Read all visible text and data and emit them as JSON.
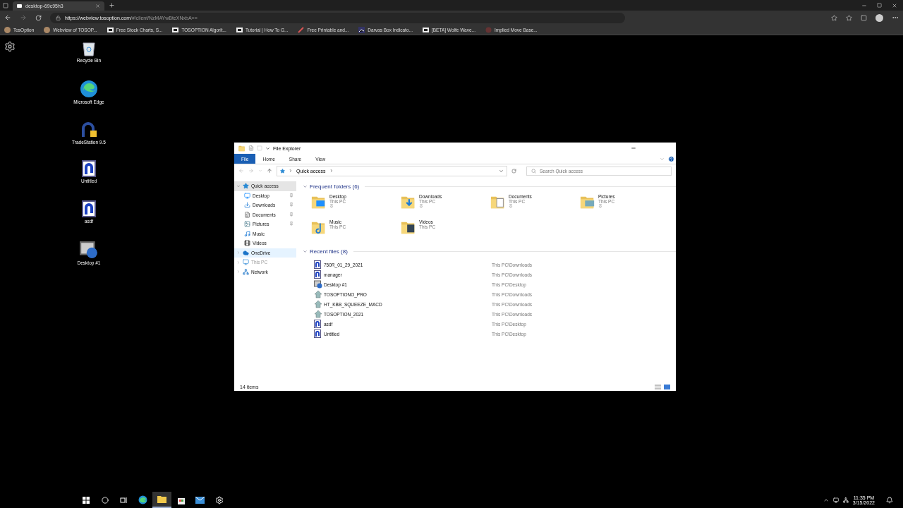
{
  "browser": {
    "tab_title": "desktop-69c95h3",
    "url_host": "https://webview.tosoption.com",
    "url_path": "/#/client/NzMAYwBteXNxbA==",
    "bookmarks": [
      {
        "label": "TosOption",
        "kind": "avatar"
      },
      {
        "label": "Webview of TOSOP...",
        "kind": "avatar"
      },
      {
        "label": "Free Stock Charts, S...",
        "kind": "tv"
      },
      {
        "label": "TOSOPTION Algorit...",
        "kind": "tv"
      },
      {
        "label": "Tutorial | How To G...",
        "kind": "tv"
      },
      {
        "label": "Free Printable and...",
        "kind": "pen"
      },
      {
        "label": "Darvas Box Indicato...",
        "kind": "chart"
      },
      {
        "label": "[BETA] Wolfe Wave...",
        "kind": "tv"
      },
      {
        "label": "Implied Move Base...",
        "kind": "dot"
      }
    ]
  },
  "desktop_icons": [
    {
      "label": "Recycle Bin",
      "kind": "recycle"
    },
    {
      "label": "Microsoft Edge",
      "kind": "edge"
    },
    {
      "label": "TradeStation 9.5",
      "kind": "trade"
    },
    {
      "label": "Untitled",
      "kind": "doc"
    },
    {
      "label": "asdf",
      "kind": "doc"
    },
    {
      "label": "Desktop #1",
      "kind": "desktop"
    }
  ],
  "explorer": {
    "title": "File Explorer",
    "ribbon_tabs": [
      {
        "label": "File",
        "selected": true
      },
      {
        "label": "Home",
        "selected": false
      },
      {
        "label": "Share",
        "selected": false
      },
      {
        "label": "View",
        "selected": false
      }
    ],
    "breadcrumb": "Quick access",
    "search": {
      "placeholder": "Search Quick access"
    },
    "nav": [
      {
        "label": "Quick access",
        "kind": "star",
        "expanded": true,
        "selected": true,
        "hovered": false,
        "children": [
          {
            "label": "Desktop",
            "kind": "desktop",
            "pinned": true
          },
          {
            "label": "Downloads",
            "kind": "downloads",
            "pinned": true
          },
          {
            "label": "Documents",
            "kind": "documents",
            "pinned": true
          },
          {
            "label": "Pictures",
            "kind": "pictures",
            "pinned": true
          },
          {
            "label": "Music",
            "kind": "music",
            "pinned": false
          },
          {
            "label": "Videos",
            "kind": "videos",
            "pinned": false
          }
        ]
      },
      {
        "label": "OneDrive",
        "kind": "cloud",
        "expanded": false,
        "selected": false,
        "hovered": true
      },
      {
        "label": "This PC",
        "kind": "pc",
        "expanded": false,
        "selected": false,
        "hovered": false
      },
      {
        "label": "Network",
        "kind": "network",
        "expanded": false,
        "selected": false,
        "hovered": false
      }
    ],
    "frequent": {
      "heading": "Frequent folders (6)",
      "expanded": true,
      "folders": [
        {
          "name": "Desktop",
          "location": "This PC",
          "pinned": true,
          "kind": "desktop"
        },
        {
          "name": "Downloads",
          "location": "This PC",
          "pinned": true,
          "kind": "downloads"
        },
        {
          "name": "Documents",
          "location": "This PC",
          "pinned": true,
          "kind": "documents"
        },
        {
          "name": "Pictures",
          "location": "This PC",
          "pinned": true,
          "kind": "pictures"
        },
        {
          "name": "Music",
          "location": "This PC",
          "pinned": false,
          "kind": "music"
        },
        {
          "name": "Videos",
          "location": "This PC",
          "pinned": false,
          "kind": "videos"
        }
      ]
    },
    "recent": {
      "heading": "Recent files (8)",
      "expanded": true,
      "files": [
        {
          "name": "750R_01_29_2021",
          "path": "This PC\\Downloads",
          "kind": "ts"
        },
        {
          "name": "manager",
          "path": "This PC\\Downloads",
          "kind": "ts"
        },
        {
          "name": "Desktop #1",
          "path": "This PC\\Desktop",
          "kind": "desktop"
        },
        {
          "name": "TOSOPTIONO_PRO",
          "path": "This PC\\Downloads",
          "kind": "els"
        },
        {
          "name": "HT_KBB_SQUEEZE_MACD",
          "path": "This PC\\Downloads",
          "kind": "els"
        },
        {
          "name": "TOSOPTION_2021",
          "path": "This PC\\Downloads",
          "kind": "els"
        },
        {
          "name": "asdf",
          "path": "This PC\\Desktop",
          "kind": "ts"
        },
        {
          "name": "Untitled",
          "path": "This PC\\Desktop",
          "kind": "ts"
        }
      ]
    },
    "status": "14 items"
  },
  "taskbar": {
    "apps": [
      {
        "kind": "start",
        "active": false
      },
      {
        "kind": "search",
        "active": false
      },
      {
        "kind": "taskview",
        "active": false
      },
      {
        "kind": "edge",
        "active": false
      },
      {
        "kind": "folder",
        "active": true
      },
      {
        "kind": "store",
        "active": false
      },
      {
        "kind": "mail",
        "active": false
      },
      {
        "kind": "gear",
        "active": false
      }
    ],
    "time": "11:35 PM",
    "date": "3/15/2022"
  }
}
